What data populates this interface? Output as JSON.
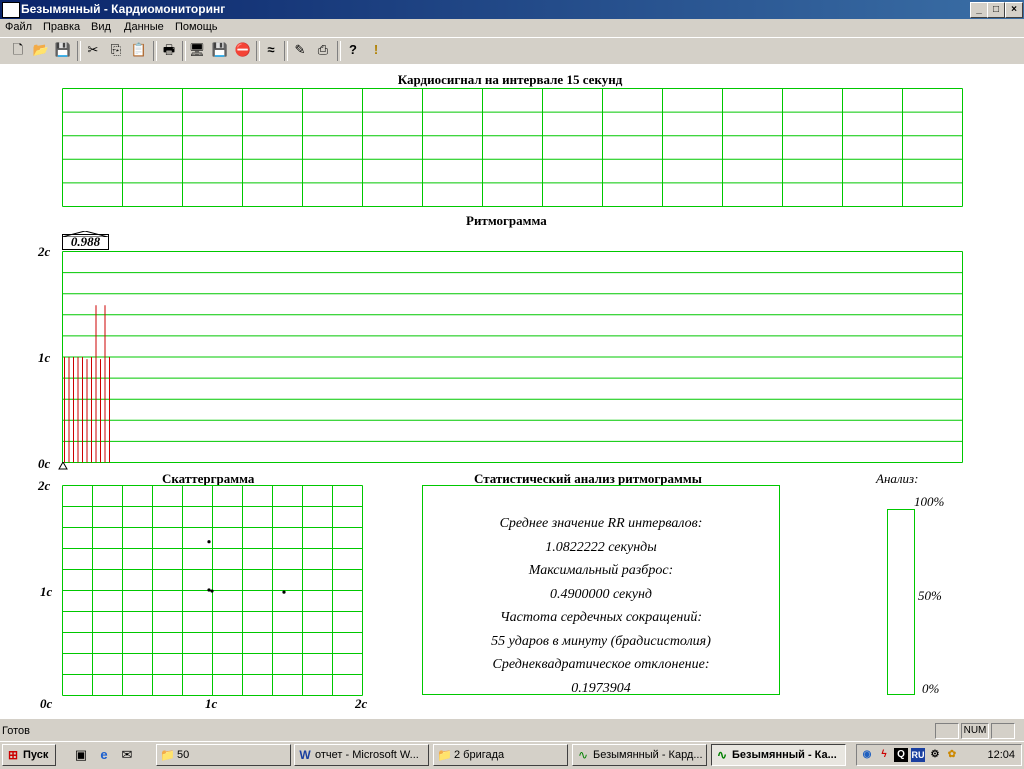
{
  "window": {
    "title": "Безымянный - Кардиомониторинг"
  },
  "caption_buttons": {
    "minimize": "_",
    "maximize": "□",
    "close": "×"
  },
  "menu": [
    {
      "label": "Файл"
    },
    {
      "label": "Правка"
    },
    {
      "label": "Вид"
    },
    {
      "label": "Данные"
    },
    {
      "label": "Помощь"
    }
  ],
  "toolbar": [
    {
      "name": "new-icon",
      "glyph": "🗋"
    },
    {
      "name": "open-icon",
      "glyph": "📂"
    },
    {
      "name": "save-icon",
      "glyph": "💾"
    },
    {
      "name": "cut-icon",
      "glyph": "✂"
    },
    {
      "name": "copy-icon",
      "glyph": "⎘"
    },
    {
      "name": "paste-icon",
      "glyph": "📋"
    },
    {
      "name": "print-icon",
      "glyph": "🖶"
    },
    {
      "name": "monitor-icon",
      "glyph": "🖥"
    },
    {
      "name": "disk-icon",
      "glyph": "💾"
    },
    {
      "name": "stop-icon",
      "glyph": "⛔"
    },
    {
      "name": "signal-wave-icon",
      "glyph": "≈"
    },
    {
      "name": "edit-pen-icon",
      "glyph": "✎"
    },
    {
      "name": "export-icon",
      "glyph": "⎙"
    },
    {
      "name": "help-icon",
      "glyph": "?"
    },
    {
      "name": "context-help-icon",
      "glyph": "!"
    }
  ],
  "cardiosignal": {
    "title": "Кардиосигнал на интервале 15 секунд"
  },
  "rhythmogram": {
    "title": "Ритмограмма",
    "current_value": "0.988",
    "y_ticks": [
      "2c",
      "1c",
      "0c"
    ]
  },
  "scattergram": {
    "title": "Скаттерграмма",
    "y_ticks": [
      "2c",
      "1c"
    ],
    "x_ticks": [
      "0c",
      "1c",
      "2c"
    ]
  },
  "statistics": {
    "title": "Статистический анализ ритмограммы",
    "lines": [
      "Среднее значение RR интервалов:",
      "1.0822222 секунды",
      "Максимальный разброс:",
      "0.4900000 секунд",
      "Частота сердечных сокращений:",
      "55 ударов в минуту (брадисистолия)",
      "Среднеквадратическое отклонение:",
      "0.1973904"
    ]
  },
  "analysis": {
    "title": "Анализ:",
    "ticks": [
      "100%",
      "50%",
      "0%"
    ]
  },
  "chart_data": [
    {
      "type": "bar",
      "title": "Ритмограмма",
      "xlabel": "",
      "ylabel": "",
      "ylim": [
        0,
        2
      ],
      "values": [
        1.0,
        1.0,
        1.0,
        1.0,
        1.0,
        0.98,
        1.0,
        1.49,
        0.98,
        1.49,
        1.0
      ],
      "grid": true,
      "color": "#cc0000"
    },
    {
      "type": "scatter",
      "title": "Скаттерграмма",
      "xlim": [
        0,
        2
      ],
      "ylim": [
        0,
        2
      ],
      "x": [
        0.98,
        0.98,
        1.0,
        1.48
      ],
      "y": [
        1.46,
        1.0,
        0.99,
        0.98
      ],
      "grid": true
    }
  ],
  "colors": {
    "grid": "#00c800",
    "bars": "#cc0000",
    "titlebar": "#0a246a"
  },
  "statusbar": {
    "text": "Готов",
    "num": "NUM"
  },
  "taskbar": {
    "start": "Пуск",
    "quicklaunch": [
      {
        "name": "show-desktop-icon",
        "glyph": "▣"
      },
      {
        "name": "ie-icon",
        "glyph": "e"
      },
      {
        "name": "outlook-icon",
        "glyph": "✉"
      }
    ],
    "tasks": [
      {
        "label": "50",
        "icon": "folder-icon",
        "glyph": "📁",
        "active": false
      },
      {
        "label": "отчет - Microsoft W...",
        "icon": "word-icon",
        "glyph": "W",
        "active": false
      },
      {
        "label": "2 бригада",
        "icon": "folder-icon",
        "glyph": "📁",
        "active": false
      },
      {
        "label": "Безымянный - Кард...",
        "icon": "cardio-app-icon",
        "glyph": "∿",
        "active": false
      },
      {
        "label": "Безымянный - Ка...",
        "icon": "cardio-app-icon",
        "glyph": "∿",
        "active": true
      }
    ],
    "tray": {
      "lang": "RU",
      "clock": "12:04"
    }
  }
}
